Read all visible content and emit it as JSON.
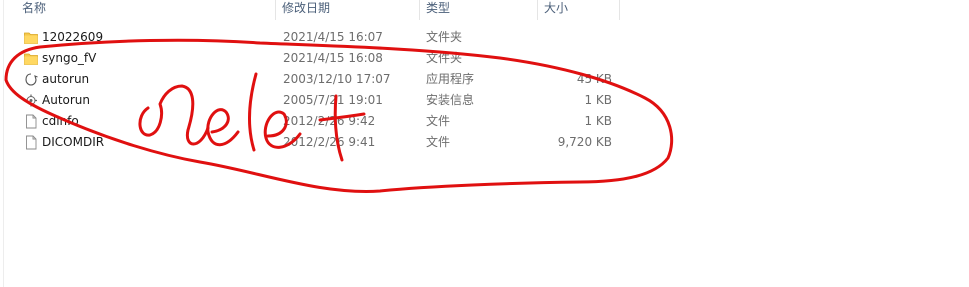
{
  "columns": {
    "name": "名称",
    "date": "修改日期",
    "type": "类型",
    "size": "大小"
  },
  "files": [
    {
      "name": "12022609",
      "date": "2021/4/15 16:07",
      "type": "文件夹",
      "size": "",
      "icon": "folder-icon"
    },
    {
      "name": "syngo_fV",
      "date": "2021/4/15 16:08",
      "type": "文件夹",
      "size": "",
      "icon": "folder-icon"
    },
    {
      "name": "autorun",
      "date": "2003/12/10 17:07",
      "type": "应用程序",
      "size": "45 KB",
      "icon": "application-icon"
    },
    {
      "name": "Autorun",
      "date": "2005/7/21 19:01",
      "type": "安装信息",
      "size": "1 KB",
      "icon": "setup-info-icon"
    },
    {
      "name": "cdinfo",
      "date": "2012/2/26 9:42",
      "type": "文件",
      "size": "1 KB",
      "icon": "file-icon"
    },
    {
      "name": "DICOMDIR",
      "date": "2012/2/26 9:41",
      "type": "文件",
      "size": "9,720 KB",
      "icon": "file-icon"
    }
  ],
  "annotation": {
    "text": "delet",
    "color": "#e01010"
  }
}
